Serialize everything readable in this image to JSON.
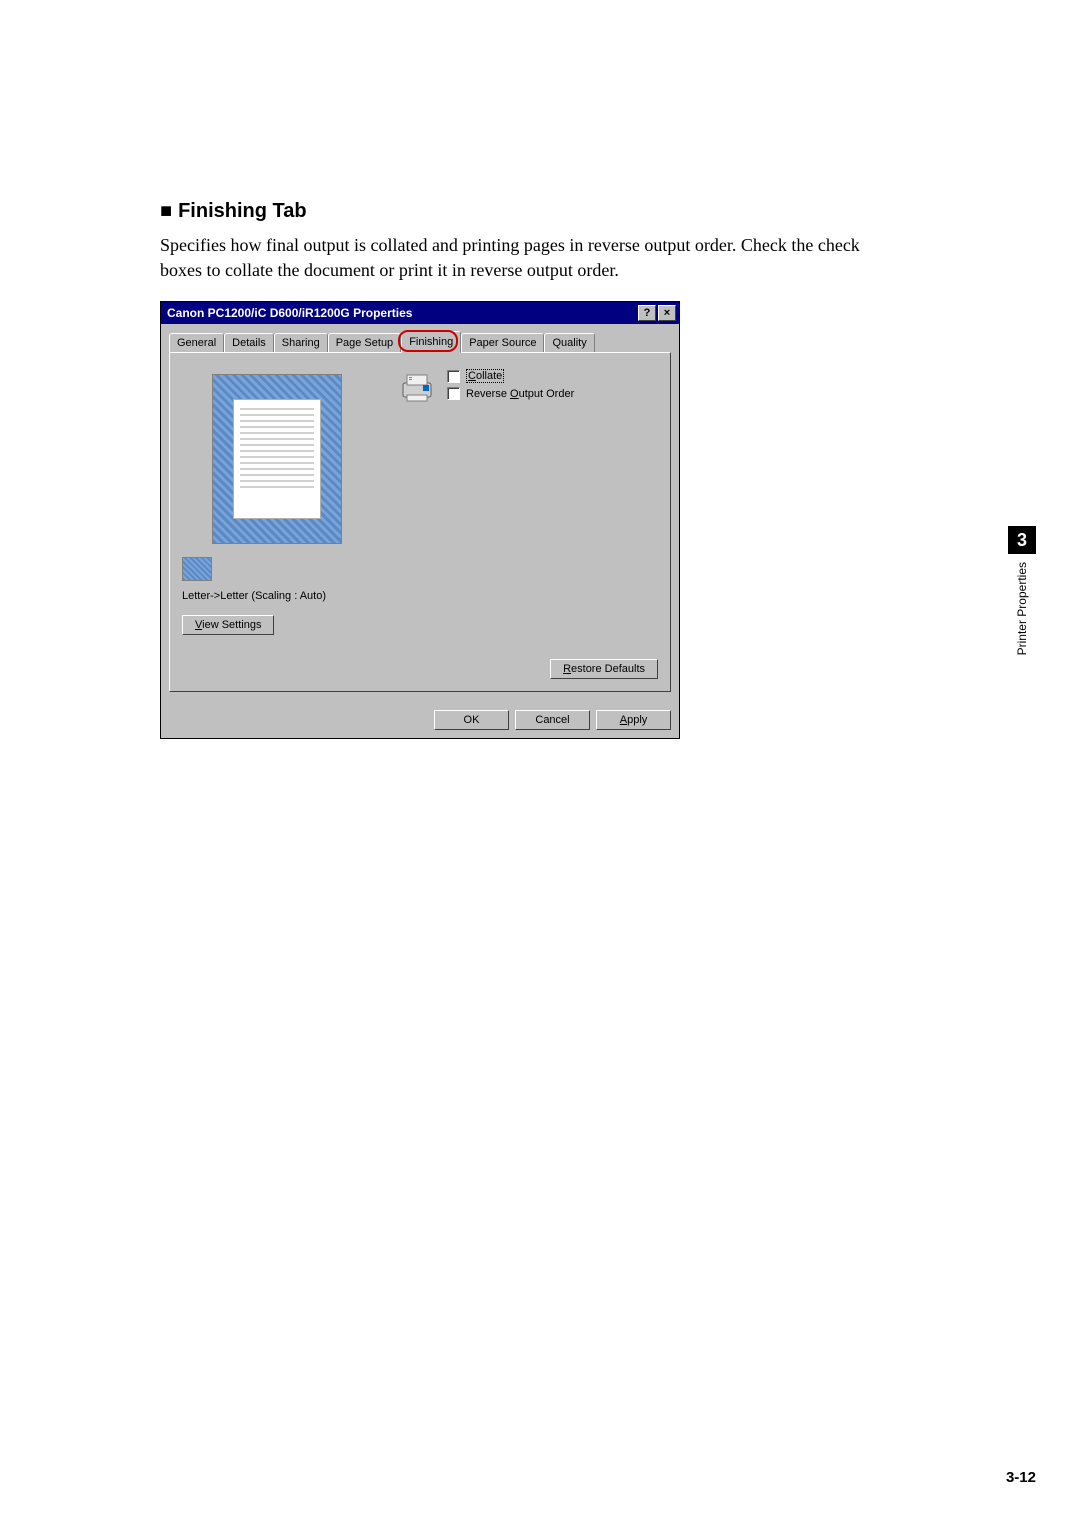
{
  "section": {
    "bullet": "■",
    "heading": "Finishing Tab",
    "body": "Specifies how final output is collated and printing pages in reverse output order. Check the check boxes to collate the document or print it in reverse output order."
  },
  "dialog": {
    "title": "Canon PC1200/iC D600/iR1200G Properties",
    "help_btn": "?",
    "close_btn": "×",
    "tabs": [
      "General",
      "Details",
      "Sharing",
      "Page Setup",
      "Finishing",
      "Paper Source",
      "Quality"
    ],
    "active_tab_index": 4,
    "preview_label": "Letter->Letter (Scaling : Auto)",
    "checkboxes": {
      "collate": {
        "char": "C",
        "rest": "ollate",
        "checked": false
      },
      "reverse": {
        "pre": "Reverse ",
        "char": "O",
        "rest": "utput Order",
        "checked": false
      }
    },
    "view_settings": {
      "char": "V",
      "rest": "iew Settings"
    },
    "restore_defaults": {
      "char": "R",
      "rest": "estore Defaults"
    },
    "footer": {
      "ok": "OK",
      "cancel": "Cancel",
      "apply": {
        "char": "A",
        "rest": "pply"
      }
    }
  },
  "sidebar": {
    "chapter": "3",
    "label": "Printer Properties"
  },
  "page_number": "3-12"
}
